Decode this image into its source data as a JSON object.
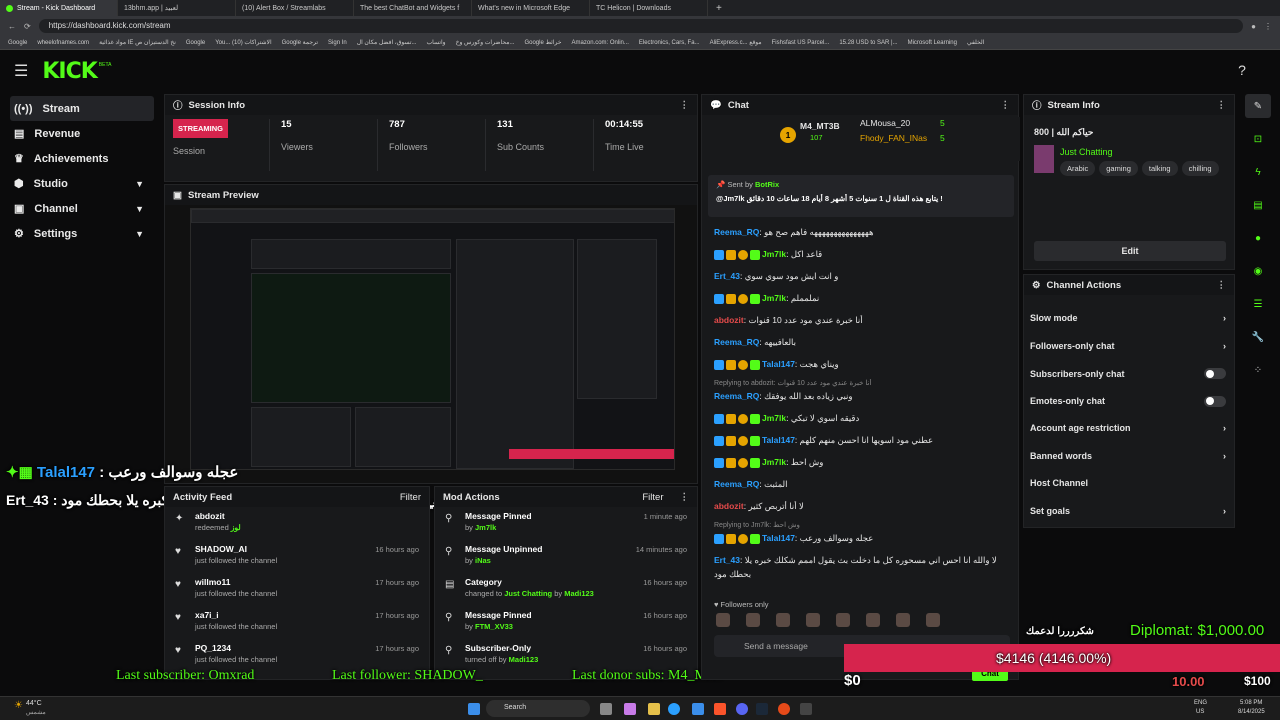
{
  "browser": {
    "tabs": [
      {
        "label": "Stream - Kick Dashboard",
        "active": true
      },
      {
        "label": "13bhm.app | لعبيد"
      },
      {
        "label": "(10) Alert Box / Streamlabs"
      },
      {
        "label": "The best ChatBot and Widgets f"
      },
      {
        "label": "What's new in Microsoft Edge"
      },
      {
        "label": "TC Helicon | Downloads"
      }
    ],
    "url": "https://dashboard.kick.com/stream",
    "bookmarks": [
      "Google",
      "wheelofnames.com",
      "مواد غذائية IE نخ الدستيزان ص",
      "Google",
      "You... الاشتراكات (10)",
      "Google ترجمة",
      "Sign In",
      "تسوق، افضل مكان ال...",
      "واتساب",
      "محاضرات وكورس وخ...",
      "Google خرائط",
      "Amazon.com: Onlin...",
      "Electronics, Cars, Fa...",
      "AliExpress.c... موقع",
      "Fishsfast US Parcel...",
      "15.28 USD to SAR |...",
      "Microsoft Learning",
      "الخلفي"
    ]
  },
  "header": {
    "logo": "KICK",
    "beta": "BETA"
  },
  "sidebar": {
    "items": [
      {
        "label": "Stream",
        "icon": "broadcast-icon"
      },
      {
        "label": "Revenue",
        "icon": "revenue-icon"
      },
      {
        "label": "Achievements",
        "icon": "trophy-icon"
      },
      {
        "label": "Studio",
        "icon": "studio-icon"
      },
      {
        "label": "Channel",
        "icon": "channel-icon"
      },
      {
        "label": "Settings",
        "icon": "gear-icon"
      }
    ]
  },
  "session": {
    "title": "Session Info",
    "badge": "STREAMING",
    "badge_label": "Session",
    "stats": [
      {
        "value": "15",
        "label": "Viewers"
      },
      {
        "value": "787",
        "label": "Followers"
      },
      {
        "value": "131",
        "label": "Sub Counts"
      },
      {
        "value": "00:14:55",
        "label": "Time Live"
      }
    ]
  },
  "preview": {
    "title": "Stream Preview"
  },
  "overlay": {
    "line1_user": "Talal147",
    "line1_text": ": عجله وسوالف ورعب",
    "line2": "Ert_43 : لا والله انا احس اني مسحوره كل ما دخلت بث يقول اممم شكلك كبره يلا بحطك مود",
    "last_subscriber": "Last subscriber: Omxrad",
    "last_follower": "Last follower: SHADOW_",
    "last_donor": "Last donor subs: M4_MT3",
    "goal_title": "شكررررا لدعمك",
    "diplomat": "Diplomat: $1,000.00",
    "goal_amount": "$4146 (4146.00%)",
    "goal_zero": "$0",
    "goal_fraction": 1.0,
    "bottom_value": "10.00",
    "bottom_right": "$100"
  },
  "activity": {
    "title": "Activity Feed",
    "filter": "Filter",
    "items": [
      {
        "name": "abdozit",
        "action": "redeemed",
        "extra": "لوز",
        "time": ""
      },
      {
        "name": "SHADOW_AI",
        "action": "just followed the channel",
        "time": "16 hours ago"
      },
      {
        "name": "willmo11",
        "action": "just followed the channel",
        "time": "17 hours ago"
      },
      {
        "name": "xa7i_i",
        "action": "just followed the channel",
        "time": "17 hours ago"
      },
      {
        "name": "PQ_1234",
        "action": "just followed the channel",
        "time": "17 hours ago"
      }
    ]
  },
  "modactions": {
    "title": "Mod Actions",
    "filter": "Filter",
    "items": [
      {
        "title": "Message Pinned",
        "sub": "by",
        "who": "Jm7lk",
        "time": "1 minute ago"
      },
      {
        "title": "Message Unpinned",
        "sub": "by",
        "who": "iNas",
        "time": "14 minutes ago"
      },
      {
        "title": "Category",
        "sub": "changed to",
        "who": "Just Chatting",
        "sub2": "by",
        "who2": "Madi123",
        "time": "16 hours ago"
      },
      {
        "title": "Message Pinned",
        "sub": "by",
        "who": "FTM_XV33",
        "time": "16 hours ago"
      },
      {
        "title": "Subscriber-Only",
        "sub": "turned off by",
        "who": "Madi123",
        "time": "16 hours ago"
      }
    ]
  },
  "chat": {
    "title": "Chat",
    "top_gifters": [
      {
        "name": "M4_MT3B",
        "count": "107"
      },
      {
        "name": "ALMousa_20",
        "count": "5"
      },
      {
        "name": "Fhody_FAN_INas",
        "count": "5"
      }
    ],
    "pinned": {
      "sent_by": "Sent by",
      "bot": "BotRix",
      "text": "@Jm7lk يتابع هذه القناة ل 1 سنوات 5 أشهر 8 أيام 18 ساعات 10 دقائق !"
    },
    "messages": [
      {
        "user": "Reema_RQ",
        "color": "#2ba0ff",
        "text": "هههههههههههههههه فاهم صح هو",
        "badges": false
      },
      {
        "user": "Jm7lk",
        "color": "#53fc18",
        "text": "قاعد اكل",
        "badges": true
      },
      {
        "user": "Ert_43",
        "color": "#2ba0ff",
        "text": "و انت ايش مود سوي سوي",
        "badges": false
      },
      {
        "user": "Jm7lk",
        "color": "#53fc18",
        "text": "نملمملم",
        "badges": true
      },
      {
        "user": "abdozit",
        "color": "#e54b4b",
        "text": "أنا خبرة عندي مود عدد 10 قنوات",
        "badges": false
      },
      {
        "user": "Reema_RQ",
        "color": "#2ba0ff",
        "text": "بالعافييهه",
        "badges": false
      },
      {
        "user": "Talal147",
        "color": "#2ba0ff",
        "text": "ويناي هجت",
        "badges": true
      },
      {
        "reply": "Replying to abdozit: أنا خبرة عندي مود عدد 10 قنوات",
        "user": "Reema_RQ",
        "color": "#2ba0ff",
        "text": "ونبي زياده بعد الله يوفقك",
        "badges": false
      },
      {
        "user": "Jm7lk",
        "color": "#53fc18",
        "text": "دقيقه اسوي لا تبكي",
        "badges": true
      },
      {
        "user": "Talal147",
        "color": "#2ba0ff",
        "text": "عطني مود اسويها انا احسن منهم كلهم",
        "badges": true
      },
      {
        "user": "Jm7lk",
        "color": "#53fc18",
        "text": "وش احط",
        "badges": true
      },
      {
        "user": "Reema_RQ",
        "color": "#2ba0ff",
        "text": "المثبت",
        "badges": false
      },
      {
        "user": "abdozit",
        "color": "#e54b4b",
        "text": "لا أنا أتربص كثير",
        "badges": false
      },
      {
        "reply": "Replying to Jm7lk: وش احط",
        "user": "Talal147",
        "color": "#2ba0ff",
        "text": "عجله وسوالف ورعب",
        "badges": true
      },
      {
        "user": "Ert_43",
        "color": "#2ba0ff",
        "text": "لا والله انا احس اني مسحوره كل ما دخلت بث يقول اممم شكلك خبره يلا",
        "text2": "بحطك مود",
        "badges": false
      }
    ],
    "followers_only": "Followers only",
    "input_placeholder": "Send a message",
    "send_button": "Chat"
  },
  "streaminfo": {
    "title": "Stream Info",
    "stream_title": "800 | حياكم الله",
    "category": "Just Chatting",
    "tags": [
      "Arabic",
      "gaming",
      "talking",
      "chilling"
    ],
    "edit": "Edit"
  },
  "chanactions": {
    "title": "Channel Actions",
    "items": [
      {
        "label": "Slow mode",
        "kind": "chevron"
      },
      {
        "label": "Followers-only chat",
        "kind": "chevron"
      },
      {
        "label": "Subscribers-only chat",
        "kind": "toggle"
      },
      {
        "label": "Emotes-only chat",
        "kind": "toggle"
      },
      {
        "label": "Account age restriction",
        "kind": "chevron"
      },
      {
        "label": "Banned words",
        "kind": "chevron"
      },
      {
        "label": "Host Channel",
        "kind": "none"
      },
      {
        "label": "Set goals",
        "kind": "chevron"
      }
    ]
  },
  "taskbar": {
    "weather_temp": "44°C",
    "weather_desc": "مشمس",
    "search": "Search",
    "lang": "ENG",
    "region": "US",
    "time": "5:08 PM",
    "date": "8/14/2025"
  },
  "colors": {
    "accent": "#53fc18",
    "streaming": "#d6244d",
    "goal_bar": "#d6244d",
    "username_blue": "#2ba0ff"
  }
}
